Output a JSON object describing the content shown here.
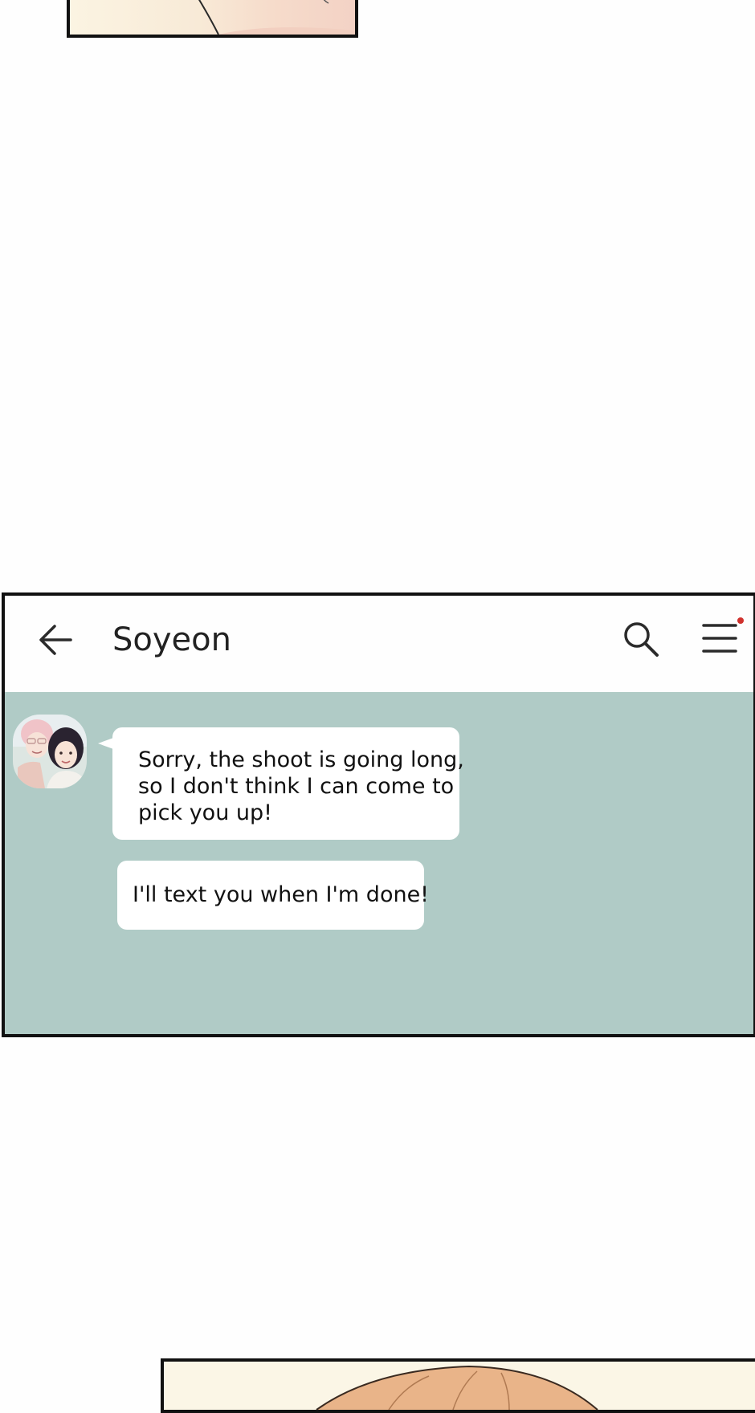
{
  "chat": {
    "contact_name": "Soyeon",
    "messages": [
      {
        "lines": [
          "Sorry, the shoot is going long,",
          "so I don't think I can come to",
          "pick you up!"
        ]
      },
      {
        "lines": [
          "I'll text you when I'm done!"
        ]
      }
    ],
    "icons": {
      "back": "back-arrow-icon",
      "search": "search-icon",
      "menu": "menu-icon"
    }
  },
  "colors": {
    "chat_background": "#b0cbc6",
    "header_background": "#fefefe",
    "bubble": "#ffffff",
    "notification_dot": "#d0312d",
    "panel_border": "#111111"
  }
}
